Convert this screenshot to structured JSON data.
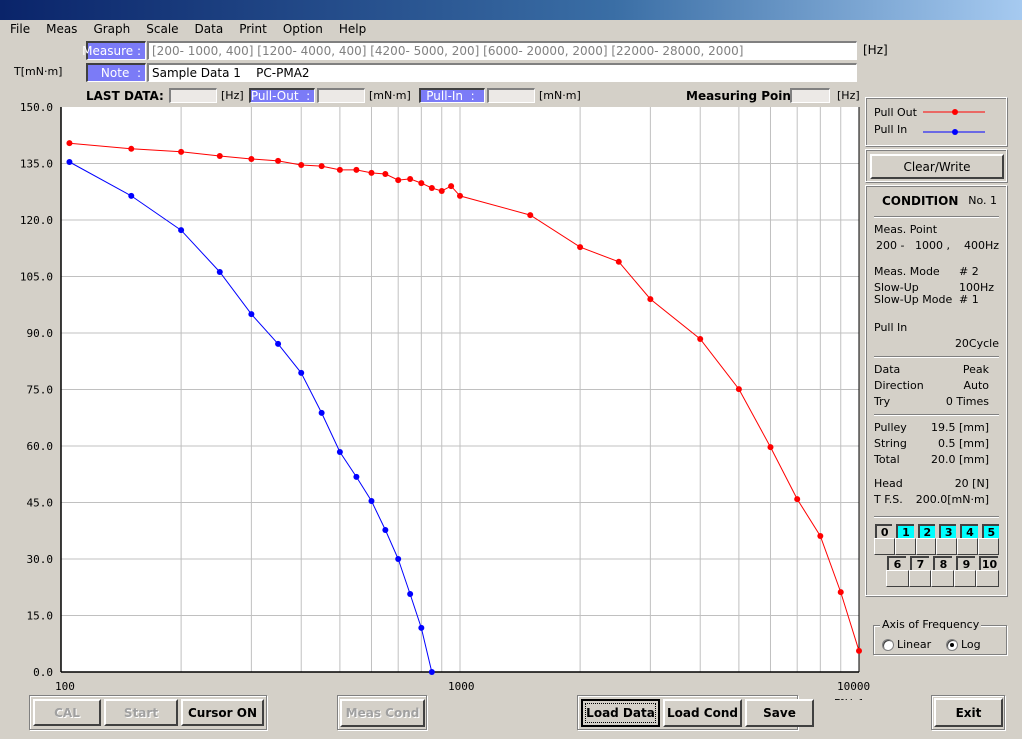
{
  "window": {
    "title": ""
  },
  "menu": [
    "File",
    "Meas",
    "Graph",
    "Scale",
    "Data",
    "Print",
    "Option",
    "Help"
  ],
  "header": {
    "measure_label": "Measure :",
    "measure_value": "[200- 1000, 400] [1200- 4000, 400] [4200- 5000, 200] [6000- 20000, 2000] [22000- 28000, 2000]",
    "measure_unit": "[Hz]",
    "note_label": "Note  :",
    "note_value": "Sample Data 1    PC-PMA2",
    "y_unit": "T[mN·m]"
  },
  "last_data": {
    "label": "LAST DATA:",
    "freq_value": "",
    "freq_unit": "[Hz]",
    "pull_out_label": "Pull-Out  :",
    "pull_out_value": "",
    "pull_out_unit": "[mN·m]",
    "pull_in_label": "Pull-In  :",
    "pull_in_value": "",
    "pull_in_unit": "[mN·m]",
    "measuring_point_label": "Measuring Point:",
    "measuring_point_value": "",
    "measuring_point_unit": "[Hz]"
  },
  "legend": {
    "items": [
      {
        "label": "Pull Out",
        "color": "#ff0000"
      },
      {
        "label": "Pull In",
        "color": "#0000ff"
      }
    ]
  },
  "clear_write_label": "Clear/Write",
  "condition": {
    "title": "CONDITION",
    "number": "No. 1",
    "meas_point_label": "Meas. Point",
    "meas_point_value": "200 -   1000 ,    400Hz",
    "meas_mode_label": "Meas. Mode",
    "meas_mode_value": "# 2",
    "slow_up_label": "Slow-Up",
    "slow_up_value": "100Hz",
    "slow_up_mode_label": "Slow-Up Mode",
    "slow_up_mode_value": "# 1",
    "pull_in_label": "Pull In",
    "pull_in_value": "20Cycle",
    "data_label": "Data",
    "data_value": "Peak",
    "direction_label": "Direction",
    "direction_value": "Auto",
    "try_label": "Try",
    "try_value": "0 Times",
    "pulley_label": "Pulley",
    "pulley_value": "19.5 [mm]",
    "string_label": "String",
    "string_value": "0.5 [mm]",
    "total_label": "Total",
    "total_value": "20.0 [mm]",
    "head_label": "Head",
    "head_value": "20 [N]",
    "tfs_label": "T F.S.",
    "tfs_value": "200.0[mN·m]"
  },
  "slots": {
    "row1": [
      {
        "n": "0",
        "on": false
      },
      {
        "n": "1",
        "on": true
      },
      {
        "n": "2",
        "on": true
      },
      {
        "n": "3",
        "on": true
      },
      {
        "n": "4",
        "on": true
      },
      {
        "n": "5",
        "on": true
      }
    ],
    "row2": [
      {
        "n": "6",
        "on": false
      },
      {
        "n": "7",
        "on": false
      },
      {
        "n": "8",
        "on": false
      },
      {
        "n": "9",
        "on": false
      },
      {
        "n": "10",
        "on": false
      }
    ]
  },
  "axis_freq": {
    "title": "Axis of Frequency",
    "options": [
      "Linear",
      "Log"
    ],
    "selected": "Log"
  },
  "buttons": {
    "cal": "CAL",
    "start": "Start",
    "cursor_on": "Cursor ON",
    "meas_cond": "Meas Cond",
    "load_data": "Load Data",
    "load_cond": "Load Cond",
    "save": "Save",
    "exit": "Exit"
  },
  "chart_data": {
    "type": "line",
    "title": "",
    "xlabel": "F[Hz]",
    "ylabel": "T[mN·m]",
    "xscale": "log",
    "xlim": [
      100,
      10000
    ],
    "ylim": [
      0,
      150
    ],
    "yticks": [
      "150.0",
      "135.0",
      "120.0",
      "105.0",
      "90.0",
      "75.0",
      "60.0",
      "45.0",
      "30.0",
      "15.0",
      "0.0"
    ],
    "xticks": [
      "100",
      "1000",
      "10000"
    ],
    "grid": true,
    "legend_position": "right-panel",
    "series": [
      {
        "name": "Pull Out",
        "color": "#ff0000",
        "x": [
          105,
          150,
          200,
          250,
          300,
          350,
          400,
          450,
          500,
          550,
          600,
          650,
          700,
          750,
          800,
          850,
          900,
          950,
          1000,
          1500,
          2000,
          2500,
          3000,
          4000,
          5000,
          6000,
          7000,
          8000,
          9000,
          10000
        ],
        "y": [
          140.4,
          138.9,
          138.1,
          137.0,
          136.2,
          135.7,
          134.6,
          134.3,
          133.3,
          133.3,
          132.5,
          132.2,
          130.6,
          130.9,
          129.8,
          128.5,
          127.7,
          129.0,
          126.4,
          121.3,
          112.8,
          108.9,
          99.0,
          88.4,
          75.1,
          59.7,
          45.9,
          36.1,
          21.2,
          5.6
        ]
      },
      {
        "name": "Pull In",
        "color": "#0000ff",
        "x": [
          105,
          150,
          200,
          250,
          300,
          350,
          400,
          450,
          500,
          550,
          600,
          650,
          700,
          750,
          800,
          850
        ],
        "y": [
          135.4,
          126.4,
          117.3,
          106.2,
          95.0,
          87.1,
          79.4,
          68.8,
          58.4,
          51.8,
          45.4,
          37.7,
          30.0,
          20.7,
          11.7,
          0.0
        ]
      }
    ]
  }
}
